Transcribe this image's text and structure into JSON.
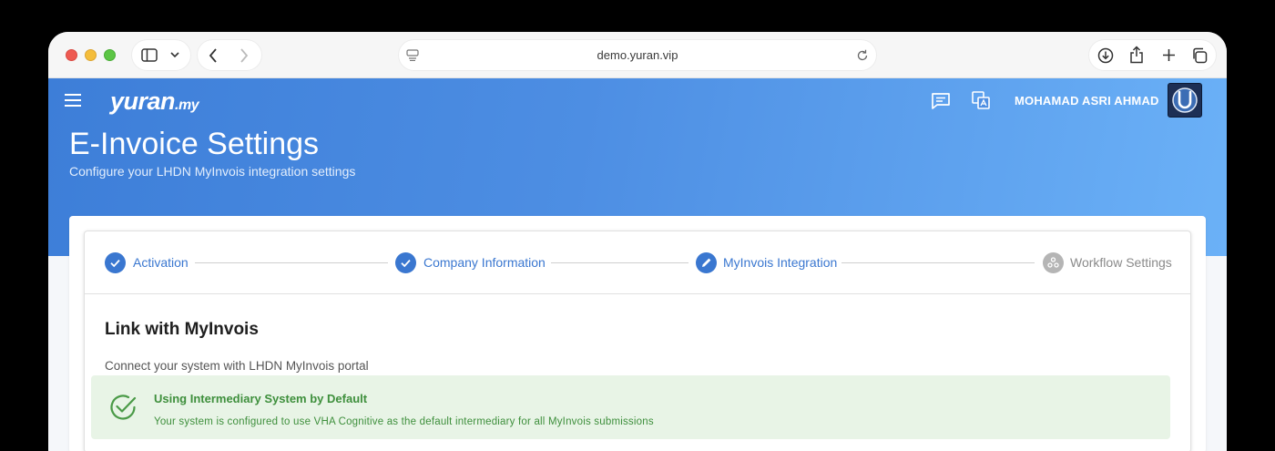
{
  "browser": {
    "url": "demo.yuran.vip"
  },
  "header": {
    "brand_main": "yuran",
    "brand_suffix": ".my",
    "user_name": "MOHAMAD ASRI AHMAD",
    "page_title": "E-Invoice Settings",
    "page_subtitle": "Configure your LHDN MyInvois integration settings"
  },
  "stepper": {
    "steps": [
      {
        "label": "Activation",
        "state": "completed",
        "icon": "check-icon"
      },
      {
        "label": "Company Information",
        "state": "completed",
        "icon": "check-icon"
      },
      {
        "label": "MyInvois Integration",
        "state": "active",
        "icon": "pencil-icon"
      },
      {
        "label": "Workflow Settings",
        "state": "pending",
        "icon": "workflow-icon"
      }
    ]
  },
  "section": {
    "title": "Link with MyInvois",
    "description": "Connect your system with LHDN MyInvois portal"
  },
  "alert": {
    "title": "Using Intermediary System by Default",
    "text": "Your system is configured to use VHA Cognitive as the default intermediary for all MyInvois submissions"
  },
  "colors": {
    "primary": "#3a77d0",
    "header_gradient_start": "#3d7ed8",
    "header_gradient_end": "#6bb1f7",
    "success_bg": "#e8f4e6",
    "success_text": "#3e8f3c",
    "pending": "#b5b5b5"
  }
}
